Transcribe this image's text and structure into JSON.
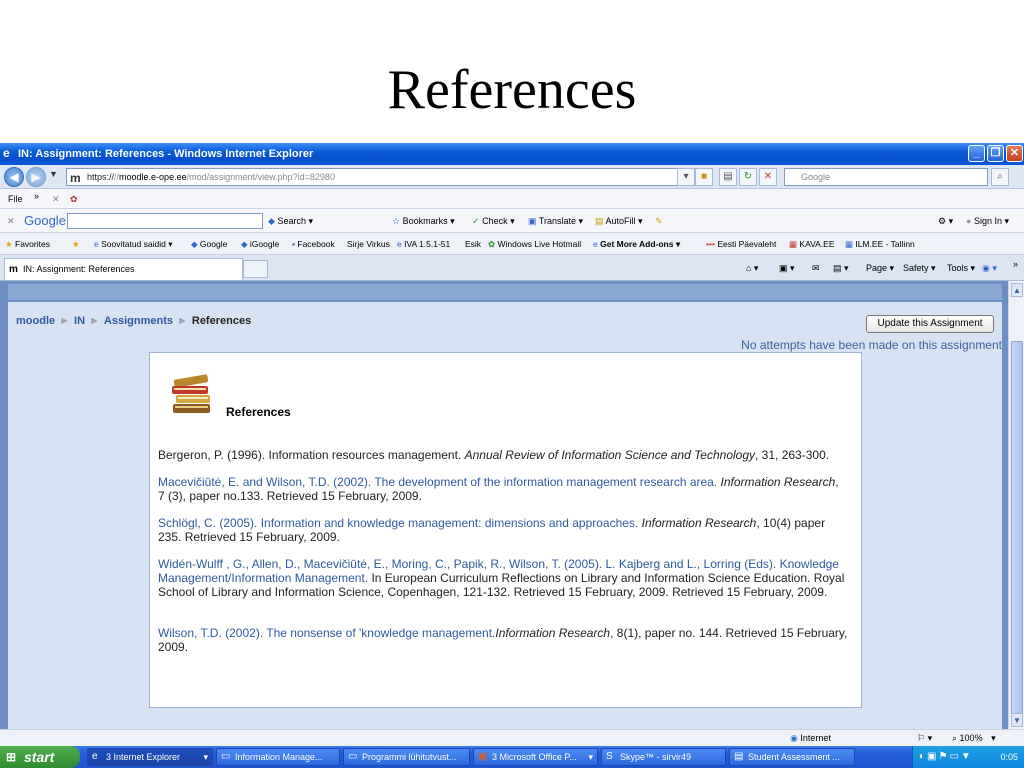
{
  "slide": {
    "title": "References"
  },
  "window": {
    "title": "IN: Assignment: References - Windows Internet Explorer",
    "controls": {
      "minimize": "_",
      "restore": "❐",
      "close": "✕"
    }
  },
  "address_bar": {
    "scheme": "https://",
    "host": "moodle.e-ope.ee",
    "path": "/mod/assignment/view.php?id=82980",
    "search_placeholder": "Google"
  },
  "menu": {
    "file": "File",
    "more": "»"
  },
  "google_toolbar": {
    "brand": "Google",
    "search": "Search",
    "bookmarks": "Bookmarks",
    "check": "Check",
    "translate": "Translate",
    "autofill": "AutoFill",
    "sign_in": "Sign In"
  },
  "favorites": {
    "label": "Favorites",
    "items": [
      "Soovitatud saidid",
      "Google",
      "iGoogle",
      "Facebook",
      "Sirje Virkus",
      "IVA 1.5.1-51",
      "Esik",
      "Windows Live Hotmail",
      "Get More Add-ons",
      "Eesti Päevaleht",
      "KAVA.EE",
      "ILM.EE - Tallinn"
    ]
  },
  "tabs": {
    "active": "IN: Assignment: References",
    "commands": {
      "page": "Page",
      "safety": "Safety",
      "tools": "Tools"
    }
  },
  "page": {
    "breadcrumb": {
      "home": "moodle",
      "course": "IN",
      "section": "Assignments",
      "current": "References",
      "separator": "►"
    },
    "update_button": "Update this Assignment",
    "attempts_note": "No attempts have been made on this assignment",
    "heading": "References",
    "references": [
      {
        "plain": "Bergeron, P. (1996). Information resources management. ",
        "italic": "Annual Review of Information Science and Technology",
        "tail": ", 31, 263-300."
      },
      {
        "plain": "Macevičiūtė, E. and Wilson, T.D. (2002). The development of the information management research area. ",
        "italic": "Information Research",
        "tail": ", 7 (3), paper no.133. Retrieved 15 February, 2009."
      },
      {
        "plain": "Schlögl, C. (2005). Information and knowledge management: dimensions and approaches. ",
        "italic": "Information Research",
        "tail": ", 10(4) paper 235. Retrieved 15 February, 2009."
      },
      {
        "plain": "Widén-Wulff , G., Allen, D., Macevičiūtė, E., Moring, C., Papik, R., Wilson, T. (2005). L. Kajberg and L., Lorring (Eds). Knowledge Management/Information Management.",
        "italic": "",
        "tail": " In European Curriculum Reflections on Library and Information Science Education. Royal School of Library and Information Science, Copenhagen, 121-132. Retrieved 15 February, 2009. Retrieved 15 February, 2009."
      },
      {
        "plain": "Wilson, T.D. (2002). The nonsense of 'knowledge management.",
        "italic": "Information Research",
        "tail": ", 8(1), paper no. 144. Retrieved 15 February, 2009."
      }
    ]
  },
  "status_bar": {
    "zone": "Internet",
    "zoom": "100%"
  },
  "taskbar": {
    "start": "start",
    "tasks": [
      "3 Internet Explorer",
      "Information Manage...",
      "Programmi lühitutvust...",
      "3 Microsoft Office P...",
      "Skype™ - sirvir49",
      "Student Assessment ..."
    ],
    "clock": "0:05"
  }
}
